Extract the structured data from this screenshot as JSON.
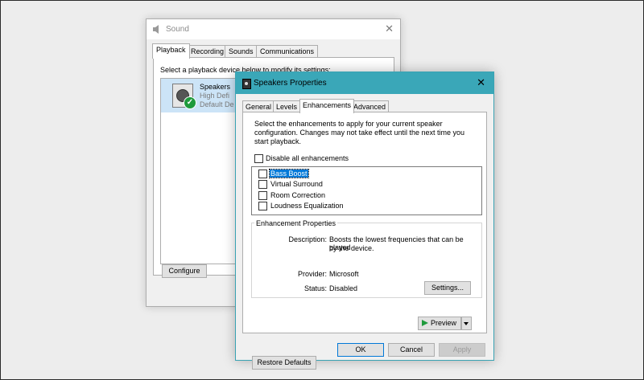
{
  "sound_window": {
    "title": "Sound",
    "close_glyph": "✕",
    "tabs": [
      "Playback",
      "Recording",
      "Sounds",
      "Communications"
    ],
    "active_tab": "Playback",
    "instruction": "Select a playback device below to modify its settings:",
    "device": {
      "name": "Speakers",
      "line2": "High Defi",
      "line3": "Default De",
      "icon": "speaker-icon",
      "status_icon": "default-check-icon",
      "check_glyph": "✓"
    },
    "configure_label": "Configure"
  },
  "properties_window": {
    "title": "Speakers Properties",
    "close_glyph": "✕",
    "tabs": [
      "General",
      "Levels",
      "Enhancements",
      "Advanced"
    ],
    "active_tab": "Enhancements",
    "description": "Select the enhancements to apply for your current speaker configuration. Changes may not take effect until the next time you start playback.",
    "disable_all_label": "Disable all enhancements",
    "enhancements": [
      {
        "label": "Bass Boost",
        "checked": false,
        "selected": true
      },
      {
        "label": "Virtual Surround",
        "checked": false,
        "selected": false
      },
      {
        "label": "Room Correction",
        "checked": false,
        "selected": false
      },
      {
        "label": "Loudness Equalization",
        "checked": false,
        "selected": false
      }
    ],
    "properties_group": {
      "title": "Enhancement Properties",
      "description_label": "Description:",
      "description_value_line1": "Boosts the lowest frequencies that can be played",
      "description_value_line2": "by the device.",
      "provider_label": "Provider:",
      "provider_value": "Microsoft",
      "status_label": "Status:",
      "status_value": "Disabled",
      "settings_label": "Settings..."
    },
    "restore_defaults_label": "Restore Defaults",
    "preview_label": "Preview",
    "ok_label": "OK",
    "cancel_label": "Cancel",
    "apply_label": "Apply"
  },
  "colors": {
    "props_titlebar": "#3aa7b8",
    "selection": "#0078d7",
    "default_check": "#1e9a3c"
  }
}
